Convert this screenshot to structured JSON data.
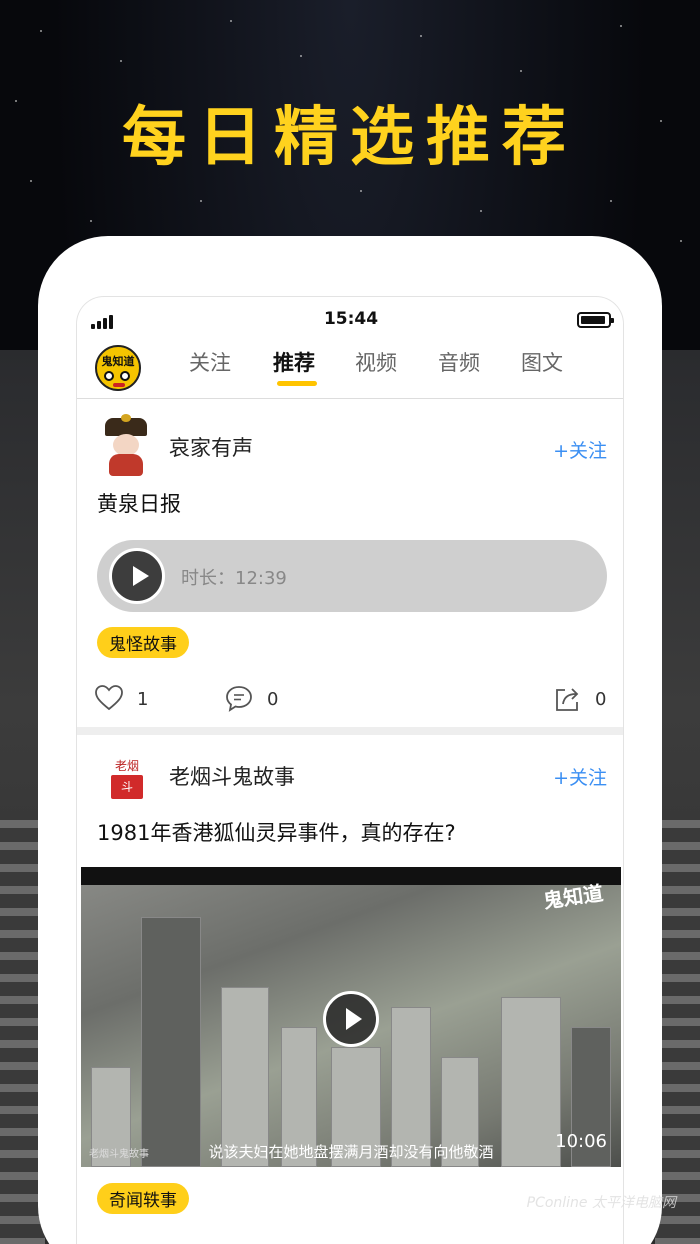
{
  "banner": {
    "headline": "每日精选推荐"
  },
  "status_bar": {
    "time": "15:44"
  },
  "nav": {
    "logo_text": "鬼知道",
    "tabs": [
      {
        "label": "关注",
        "active": false
      },
      {
        "label": "推荐",
        "active": true
      },
      {
        "label": "视频",
        "active": false
      },
      {
        "label": "音频",
        "active": false
      },
      {
        "label": "图文",
        "active": false
      }
    ]
  },
  "posts": [
    {
      "author": "哀家有声",
      "follow_label": "+关注",
      "title": "黄泉日报",
      "audio_duration": "时长：12:39",
      "tag": "鬼怪故事",
      "likes": "1",
      "comments": "0",
      "shares": "0"
    },
    {
      "author": "老烟斗鬼故事",
      "follow_label": "+关注",
      "avatar_text_top": "老烟",
      "avatar_text_stamp": "斗",
      "title": "1981年香港狐仙灵异事件，真的存在?",
      "video": {
        "watermark": "鬼知道",
        "subtitle": "说该夫妇在她地盘摆满月酒却没有向他敬酒",
        "channel": "老烟斗鬼故事",
        "duration": "10:06"
      },
      "tag": "奇闻轶事"
    }
  ],
  "credit": "PConline 太平洋电脑网",
  "colors": {
    "accent_yellow": "#ffcf1a",
    "headline_yellow": "#ffd21e",
    "follow_blue": "#3b8ff3"
  }
}
